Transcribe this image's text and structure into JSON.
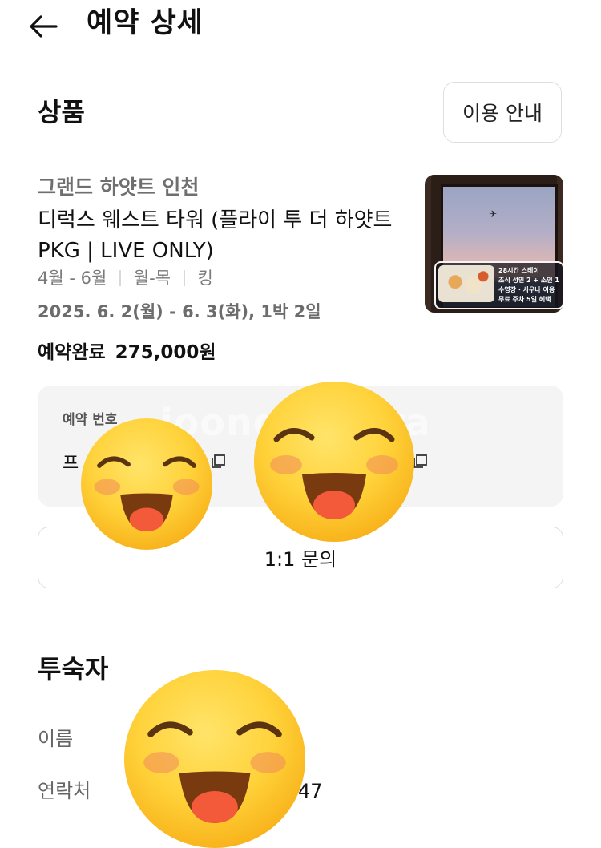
{
  "header": {
    "title": "예약 상세"
  },
  "product": {
    "section_title": "상품",
    "guide_button": "이용 안내",
    "hotel_name": "그랜드 하얏트 인천",
    "room_name": "디럭스 웨스트 타워 (플라이 투 더 하얏트 PKG | LIVE ONLY)",
    "meta": [
      "4월 - 6월",
      "월-목",
      "킹"
    ],
    "dates": "2025. 6. 2(월) - 6. 3(화), 1박 2일",
    "status": "예약완료",
    "price": "275,000원",
    "thumbnail_badge_lines": [
      "28시간 스테이",
      "조식 성인 2 + 소인 1",
      "수영장 · 사우나 이용",
      "무료 주차 5일 혜택"
    ]
  },
  "reservation": {
    "label": "예약 번호",
    "value_prefix": "프"
  },
  "inquiry_button": "1:1 문의",
  "guest": {
    "section_title": "투숙자",
    "name_label": "이름",
    "phone_label": "연락처",
    "phone_visible_tail": "47"
  },
  "overlay": {
    "watermark": "joonggonara"
  },
  "colors": {
    "accent_text": "#111111",
    "muted_text": "#6f6f6f",
    "card_bg": "#f4f4f4",
    "border": "#dedede"
  }
}
